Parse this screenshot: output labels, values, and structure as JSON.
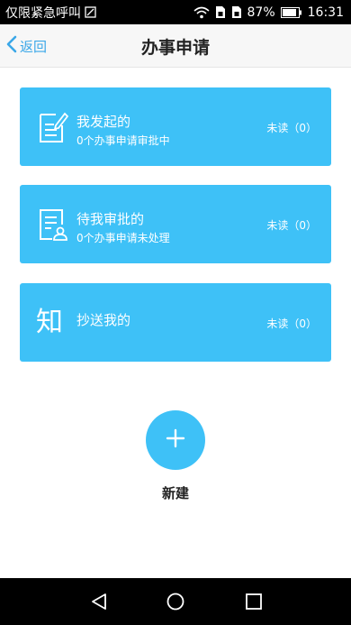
{
  "status_bar": {
    "carrier": "仅限紧急呼叫",
    "battery": "87%",
    "time": "16:31",
    "icons": [
      "sim-icon",
      "wifi-icon",
      "sim-card-icon",
      "sim-card-icon",
      "battery-icon"
    ]
  },
  "header": {
    "back_label": "返回",
    "title": "办事申请"
  },
  "cards": [
    {
      "title": "我发起的",
      "subtitle": "0个办事申请审批中",
      "unread": "未读（0）",
      "icon": "edit-document-icon"
    },
    {
      "title": "待我审批的",
      "subtitle": "0个办事申请未处理",
      "unread": "未读（0）",
      "icon": "approval-document-icon"
    },
    {
      "title": "抄送我的",
      "subtitle": "",
      "unread": "未读（0）",
      "icon": "know-character-icon",
      "icon_text": "知"
    }
  ],
  "add_button": {
    "label": "新建"
  },
  "nav": {
    "buttons": [
      "back-triangle-icon",
      "home-circle-icon",
      "recents-square-icon"
    ]
  },
  "colors": {
    "accent": "#3ec1f7",
    "link": "#3aa7e8",
    "bars": "#000000"
  }
}
